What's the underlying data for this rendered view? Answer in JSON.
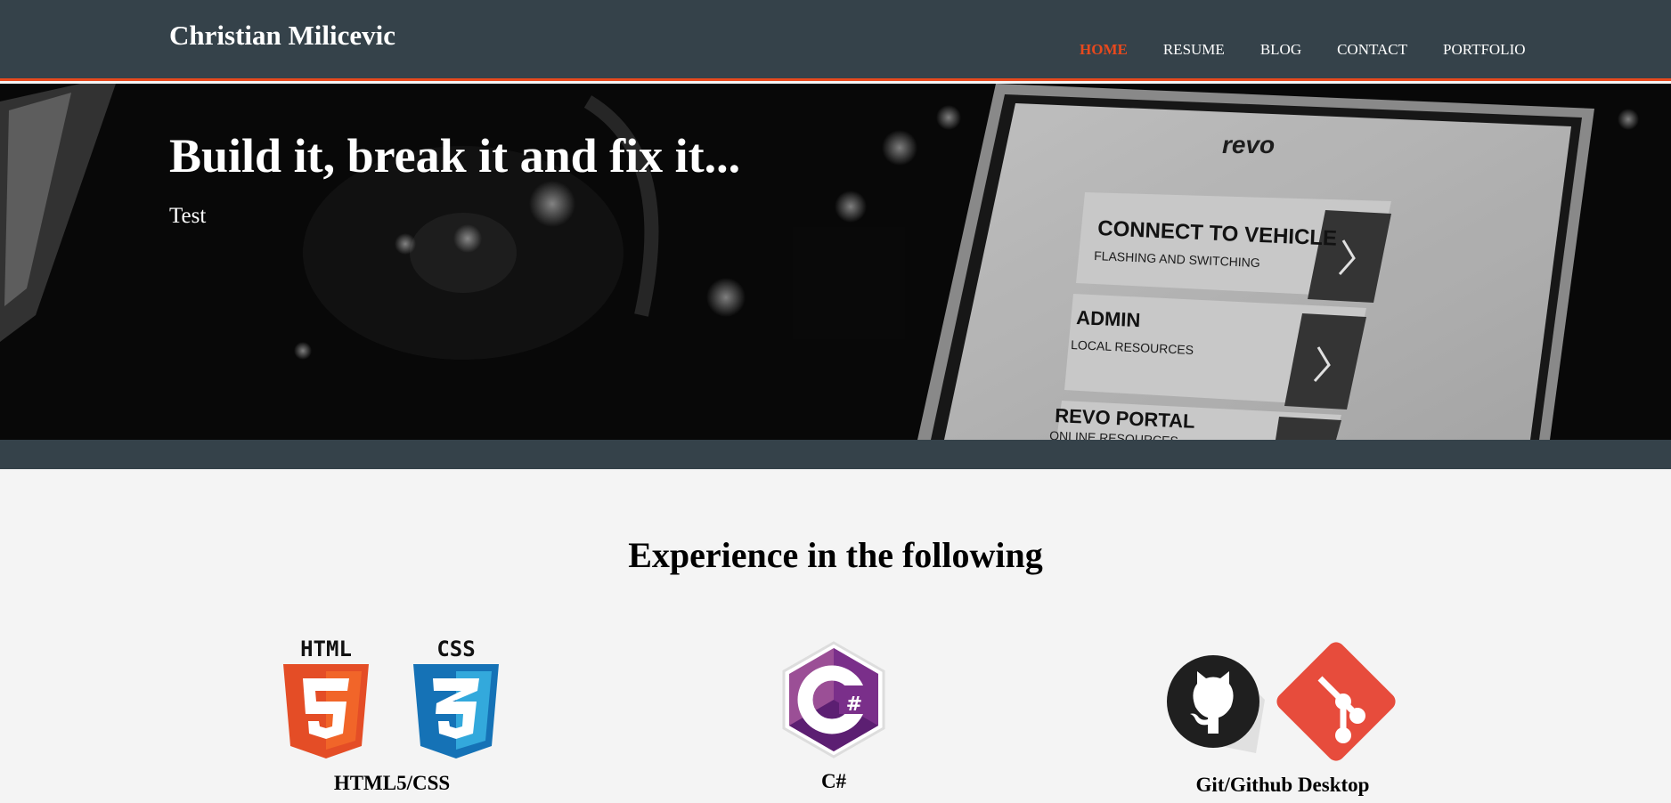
{
  "site": {
    "brand": "Christian Milicevic",
    "accent_color": "#e8491d",
    "header_color": "#35424a"
  },
  "nav": {
    "items": [
      {
        "label": "HOME",
        "active": true
      },
      {
        "label": "RESUME",
        "active": false
      },
      {
        "label": "BLOG",
        "active": false
      },
      {
        "label": "CONTACT",
        "active": false
      },
      {
        "label": "PORTFOLIO",
        "active": false
      }
    ]
  },
  "hero": {
    "title": "Build it, break it and fix it...",
    "subtitle": "Test",
    "laptop": {
      "logo": "revo",
      "items": [
        {
          "title": "CONNECT TO VEHICLE",
          "sub": "FLASHING AND SWITCHING"
        },
        {
          "title": "ADMIN",
          "sub": "LOCAL RESOURCES"
        },
        {
          "title": "REVO PORTAL",
          "sub": "ONLINE RESOURCES"
        }
      ]
    }
  },
  "experience": {
    "title": "Experience in the following",
    "skills": [
      {
        "label": "HTML5/CSS",
        "icons": [
          "html5-icon",
          "css3-icon"
        ]
      },
      {
        "label": "C#",
        "icons": [
          "csharp-icon"
        ]
      },
      {
        "label": "Git/Github Desktop",
        "icons": [
          "github-icon",
          "git-icon"
        ]
      }
    ]
  }
}
